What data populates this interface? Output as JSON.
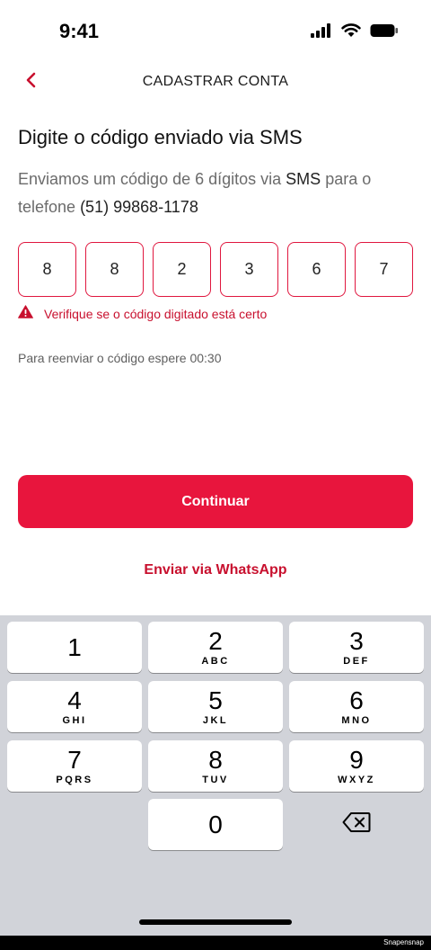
{
  "status_bar": {
    "time": "9:41",
    "icons": [
      "signal-icon",
      "wifi-icon",
      "battery-icon"
    ]
  },
  "header": {
    "back_icon": "chevron-left-icon",
    "title": "CADASTRAR CONTA"
  },
  "heading": "Digite o código enviado via SMS",
  "subtitle": {
    "text_before": "Enviamos um código de 6 dígitos via ",
    "channel": "SMS",
    "text_middle": " para o telefone ",
    "phone": "(51) 99868-1178"
  },
  "code_digits": [
    "8",
    "8",
    "2",
    "3",
    "6",
    "7"
  ],
  "error": {
    "icon": "warning-icon",
    "text": "Verifique se o código digitado está certo"
  },
  "resend_text": "Para reenviar o código espere 00:30",
  "continue_button": "Continuar",
  "whatsapp_link": "Enviar via WhatsApp",
  "keyboard": {
    "keys": [
      {
        "num": "1",
        "letters": ""
      },
      {
        "num": "2",
        "letters": "ABC"
      },
      {
        "num": "3",
        "letters": "DEF"
      },
      {
        "num": "4",
        "letters": "GHI"
      },
      {
        "num": "5",
        "letters": "JKL"
      },
      {
        "num": "6",
        "letters": "MNO"
      },
      {
        "num": "7",
        "letters": "PQRS"
      },
      {
        "num": "8",
        "letters": "TUV"
      },
      {
        "num": "9",
        "letters": "WXYZ"
      },
      {
        "num": "0",
        "letters": ""
      }
    ],
    "delete_icon": "backspace-icon"
  },
  "footer": "Snapensnap",
  "colors": {
    "accent": "#e8153d",
    "error": "#c8102e",
    "keyboard_bg": "#d1d3d9"
  }
}
